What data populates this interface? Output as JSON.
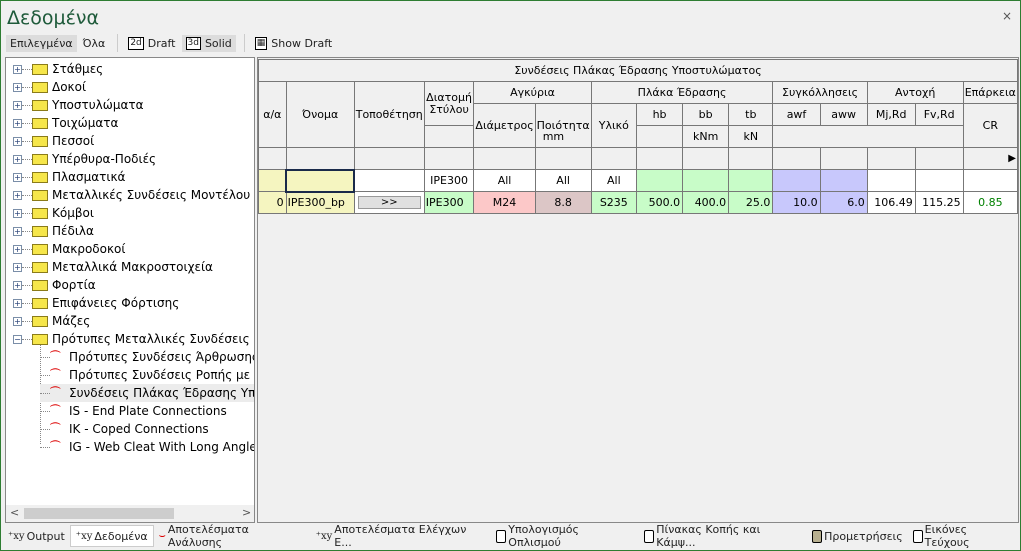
{
  "window": {
    "title": "Δεδομένα",
    "close": "×"
  },
  "toolbar": {
    "selected": "Επιλεγμένα",
    "all": "Όλα",
    "draft_icon": "2d",
    "draft": "Draft",
    "solid_icon": "3d",
    "solid": "Solid",
    "show_draft": "Show Draft"
  },
  "tree": {
    "items": [
      "Στάθμες",
      "Δοκοί",
      "Υποστυλώματα",
      "Τοιχώματα",
      "Πεσσοί",
      "Υπέρθυρα-Ποδιές",
      "Πλασματικά",
      "Μεταλλικές Συνδέσεις Μοντέλου",
      "Κόμβοι",
      "Πέδιλα",
      "Μακροδοκοί",
      "Μεταλλικά Μακροστοιχεία",
      "Φορτία",
      "Επιφάνειες Φόρτισης",
      "Μάζες",
      "Πρότυπες Μεταλλικές Συνδέσεις"
    ],
    "children": [
      "Πρότυπες Συνδέσεις Άρθρωσης με",
      "Πρότυπες Συνδέσεις Ροπής με Μετ",
      "Συνδέσεις Πλάκας Έδρασης Υποστ",
      "IS - End Plate Connections",
      "IK - Coped Connections",
      "IG - Web Cleat With Long Angles Co"
    ]
  },
  "table": {
    "title": "Συνδέσεις Πλάκας Έδρασης Υποστυλώματος",
    "headers": {
      "aa": "α/α",
      "name": "Όνομα",
      "placement": "Τοποθέτηση",
      "section": "Διατομή Στύλου",
      "anchors": "Αγκύρια",
      "diameter": "Διάμετρος",
      "quality": "Ποιότητα",
      "plate": "Πλάκα Έδρασης",
      "material": "Υλικό",
      "hb": "hb",
      "bb": "bb",
      "tb": "tb",
      "welds": "Συγκόλλησεις",
      "awf": "awf",
      "aww": "aww",
      "resistance": "Αντοχή",
      "mj": "Mj,Rd",
      "fv": "Fv,Rd",
      "adequacy": "Επάρκεια",
      "cr": "CR",
      "mm": "mm",
      "knm": "kNm",
      "kn": "kN",
      "arrow": "▶"
    },
    "filter": {
      "section": "IPE300",
      "diameter": "All",
      "quality": "All",
      "material": "All"
    },
    "row": {
      "aa": "0",
      "name": "IPE300_bp",
      "placement": ">>",
      "section": "IPE300",
      "diameter": "M24",
      "quality": "8.8",
      "material": "S235",
      "hb": "500.0",
      "bb": "400.0",
      "tb": "25.0",
      "awf": "10.0",
      "aww": "6.0",
      "mj": "106.49",
      "fv": "115.25",
      "cr": "0.85"
    },
    "cr_color": "#008000"
  },
  "bottom_tabs": [
    "Output",
    "Δεδομένα",
    "Αποτελέσματα Ανάλυσης",
    "Αποτελέσματα Ελέγχων Ε...",
    "Υπολογισμός Οπλισμού",
    "Πίνακας Κοπής και Κάμψ...",
    "Προμετρήσεις",
    "Εικόνες Τεύχους"
  ]
}
